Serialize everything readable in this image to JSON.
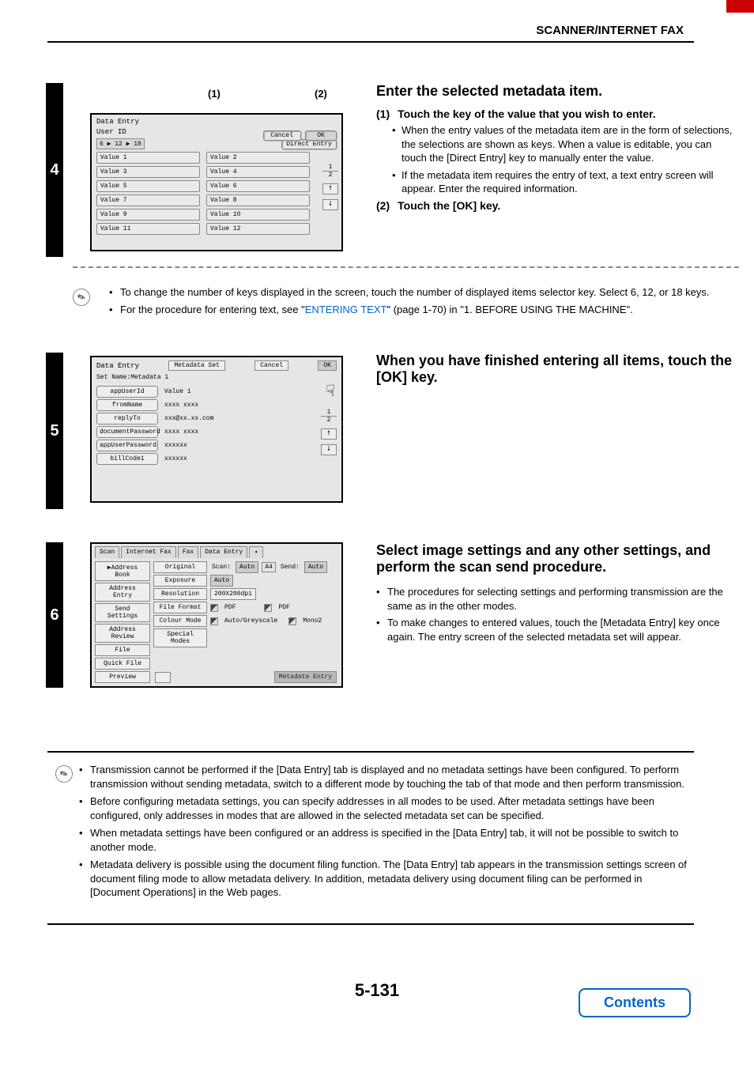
{
  "header": {
    "title": "SCANNER/INTERNET FAX"
  },
  "step4": {
    "number": "4",
    "callouts": {
      "c1": "(1)",
      "c2": "(2)"
    },
    "panel": {
      "title": "Data Entry",
      "subtitle": "User ID",
      "selector": "6 ▶ 12 ▶ 18",
      "cancel": "Cancel",
      "ok": "OK",
      "direct_entry": "Direct Entry",
      "values": [
        "Value 1",
        "Value 2",
        "Value 3",
        "Value 4",
        "Value 5",
        "Value 6",
        "Value 7",
        "Value 8",
        "Value 9",
        "Value 10",
        "Value 11",
        "Value 12"
      ],
      "page_top": "1",
      "page_bot": "2"
    },
    "right": {
      "heading": "Enter the selected metadata item.",
      "sub1_num": "(1)",
      "sub1": "Touch the key of the value that you wish to enter.",
      "b1": "When the entry values of the metadata item are in the form of selections, the selections are shown as keys. When a value is editable, you can touch the [Direct Entry] key to manually enter the value.",
      "b2": "If the metadata item requires the entry of text, a text entry screen will appear. Enter the required information.",
      "sub2_num": "(2)",
      "sub2": "Touch the [OK] key."
    },
    "note": {
      "b1": "To change the number of keys displayed in the screen, touch the number of displayed items selector key. Select 6, 12, or 18 keys.",
      "b2a": "For the procedure for entering text, see \"",
      "b2link": "ENTERING TEXT",
      "b2b": "\" (page 1-70) in \"1. BEFORE USING THE MACHINE\"."
    }
  },
  "step5": {
    "number": "5",
    "panel": {
      "tab": "Data Entry",
      "meta": "Metadata Set",
      "cancel": "Cancel",
      "ok": "OK",
      "setname": "Set Name:Metadata 1",
      "rows": [
        {
          "k": "appUserId",
          "v": "Value 1"
        },
        {
          "k": "fromName",
          "v": "xxxx xxxx"
        },
        {
          "k": "replyTo",
          "v": "xxx@xx.xx.com"
        },
        {
          "k": "documentPassword",
          "v": "xxxx xxxx"
        },
        {
          "k": "appUserPassword",
          "v": "xxxxxx"
        },
        {
          "k": "billCode1",
          "v": "xxxxxx"
        }
      ],
      "page_top": "1",
      "page_bot": "2"
    },
    "right": {
      "heading": "When you have finished entering all items, touch the [OK] key."
    }
  },
  "step6": {
    "number": "6",
    "panel": {
      "tabs": [
        "Scan",
        "Internet Fax",
        "Fax",
        "Data Entry",
        "➧"
      ],
      "side": [
        "▶Address Book",
        "Address Entry",
        "Send Settings",
        "Address Review",
        "File",
        "Quick File",
        "Preview"
      ],
      "rows": {
        "original": {
          "k": "Original",
          "l1": "Scan:",
          "v1": "Auto",
          "a4": "A4",
          "l2": "Send:",
          "v2": "Auto"
        },
        "exposure": {
          "k": "Exposure",
          "v": "Auto"
        },
        "resolution": {
          "k": "Resolution",
          "v": "200X200dpi"
        },
        "fileformat": {
          "k": "File Format",
          "v1": "PDF",
          "v2": "PDF"
        },
        "colour": {
          "k": "Colour Mode",
          "v1": "Auto/Greyscale",
          "v2": "Mono2"
        },
        "special": {
          "k": "Special Modes"
        }
      },
      "meta_entry": "Metadata Entry"
    },
    "right": {
      "heading": "Select image settings and any other settings, and perform the scan send procedure.",
      "b1": "The procedures for selecting settings and performing transmission are the same as in the other modes.",
      "b2": "To make changes to entered values, touch the [Metadata Entry] key once again. The entry screen of the selected metadata set will appear."
    }
  },
  "bottom_note": {
    "b1": "Transmission cannot be performed if the [Data Entry] tab is displayed and no metadata settings have been configured. To perform transmission without sending metadata, switch to a different mode by touching the tab of that mode and then perform transmission.",
    "b2": "Before configuring metadata settings, you can specify addresses in all modes to be used. After metadata settings have been configured, only addresses in modes that are allowed in the selected metadata set can be specified.",
    "b3": "When metadata settings have been configured or an address is specified in the [Data Entry] tab, it will not be possible to switch to another mode.",
    "b4": "Metadata delivery is possible using the document filing function. The [Data Entry] tab appears in the transmission settings screen of document filing mode to allow metadata delivery. In addition, metadata delivery using document filing can be performed in [Document Operations] in the Web pages."
  },
  "footer": {
    "page": "5-131",
    "contents": "Contents"
  }
}
